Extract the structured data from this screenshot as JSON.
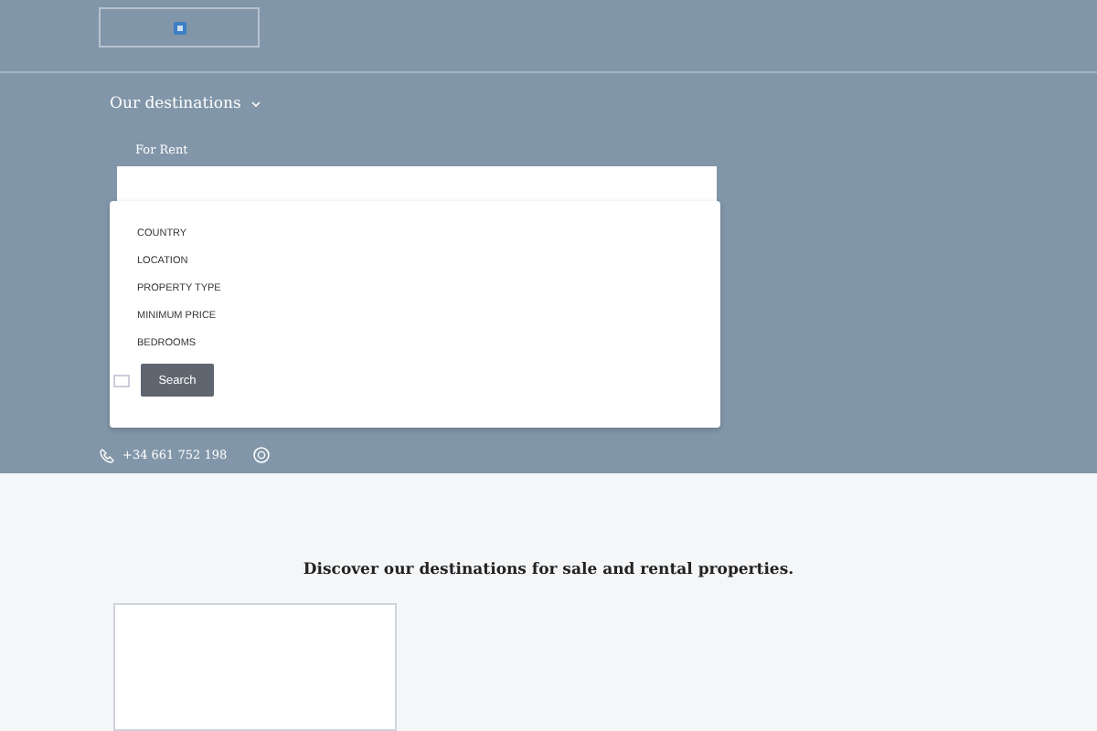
{
  "header": {
    "menu": {
      "label": "Our destinations"
    },
    "tab": "For Rent"
  },
  "search_form": {
    "fields": [
      "COUNTRY",
      "LOCATION",
      "PROPERTY TYPE",
      "MINIMUM PRICE",
      "BEDROOMS"
    ],
    "checkbox": {
      "checked": false
    },
    "button": "Search"
  },
  "contact": {
    "phone": "+34 661 752 198"
  },
  "section": {
    "title": "Discover our destinations for sale and rental properties."
  }
}
